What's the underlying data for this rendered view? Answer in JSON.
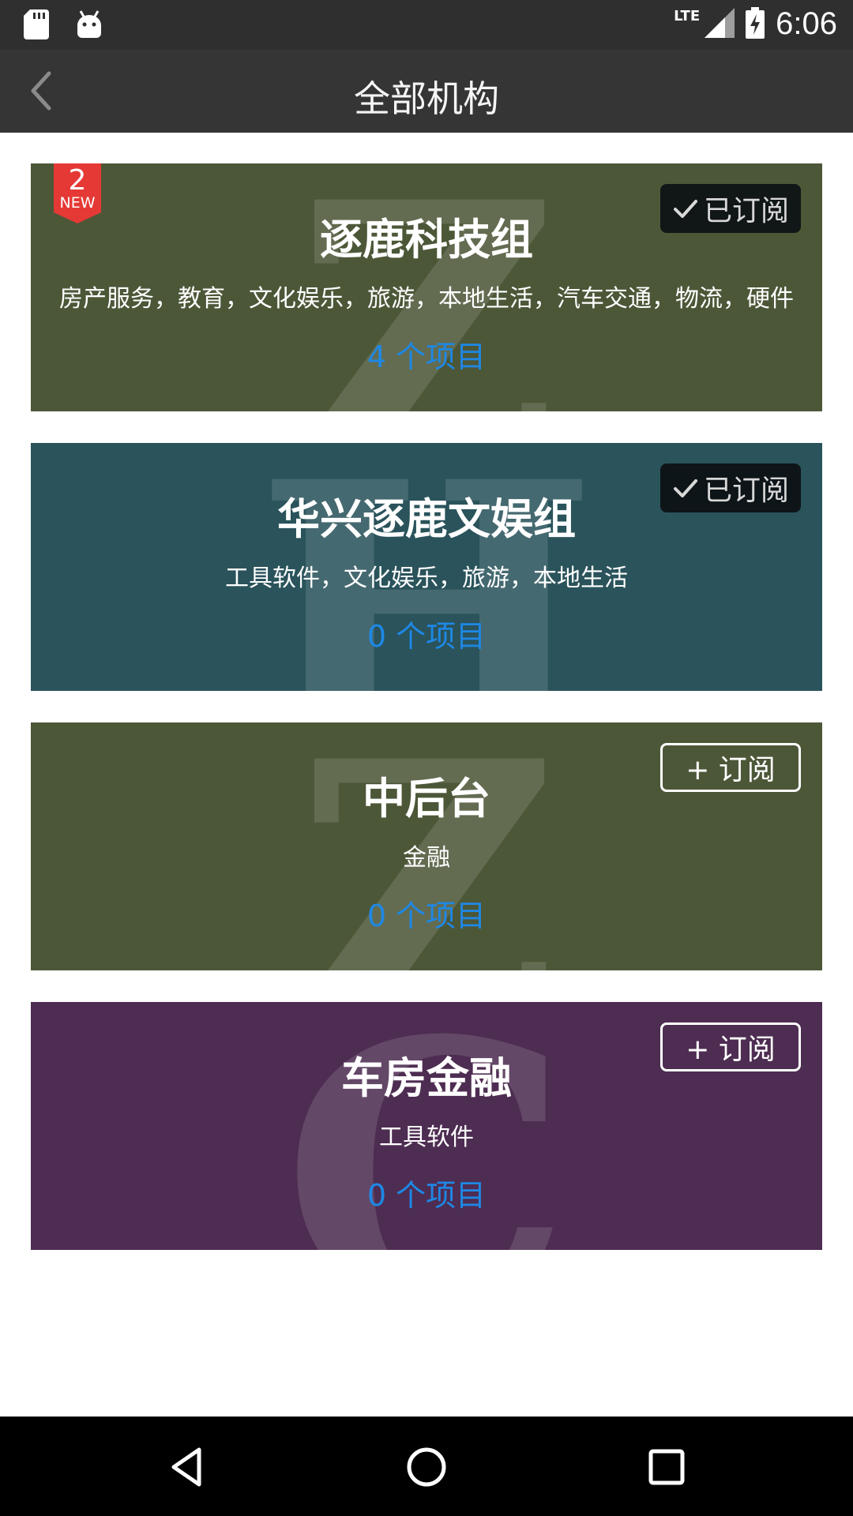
{
  "status_bar": {
    "time": "6:06",
    "network": "LTE",
    "icons": [
      "sd-card-icon",
      "android-icon",
      "signal-icon",
      "battery-charging-icon"
    ]
  },
  "app_bar": {
    "title": "全部机构",
    "back_icon": "chevron-left-icon"
  },
  "cards": [
    {
      "name": "逐鹿科技组",
      "tags": "房产服务，教育，文化娱乐，旅游，本地生活，汽车交通，物流，硬件",
      "count": "4 个项目",
      "subscribe_label": "已订阅",
      "subscribed": true,
      "bg_color": "#4c5738",
      "watermark": "Z",
      "badge": {
        "number": "2",
        "label": "NEW",
        "color": "#e53935"
      }
    },
    {
      "name": "华兴逐鹿文娱组",
      "tags": "工具软件，文化娱乐，旅游，本地生活",
      "count": "0 个项目",
      "subscribe_label": "已订阅",
      "subscribed": true,
      "bg_color": "#2a535b",
      "watermark": "H"
    },
    {
      "name": "中后台",
      "tags": "金融",
      "count": "0 个项目",
      "subscribe_label": "+ 订阅",
      "subscribed": false,
      "bg_color": "#4c5738",
      "watermark": "Z"
    },
    {
      "name": "车房金融",
      "tags": "工具软件",
      "count": "0 个项目",
      "subscribe_label": "+ 订阅",
      "subscribed": false,
      "bg_color": "#4e2d52",
      "watermark": "C"
    }
  ],
  "nav_bar": {
    "icons": [
      "back-triangle-icon",
      "home-circle-icon",
      "recents-square-icon"
    ]
  },
  "colors": {
    "status_bar": "#2f2f2f",
    "app_bar": "#353535",
    "count_text": "#1e88e5",
    "nav_bar": "#000000"
  }
}
